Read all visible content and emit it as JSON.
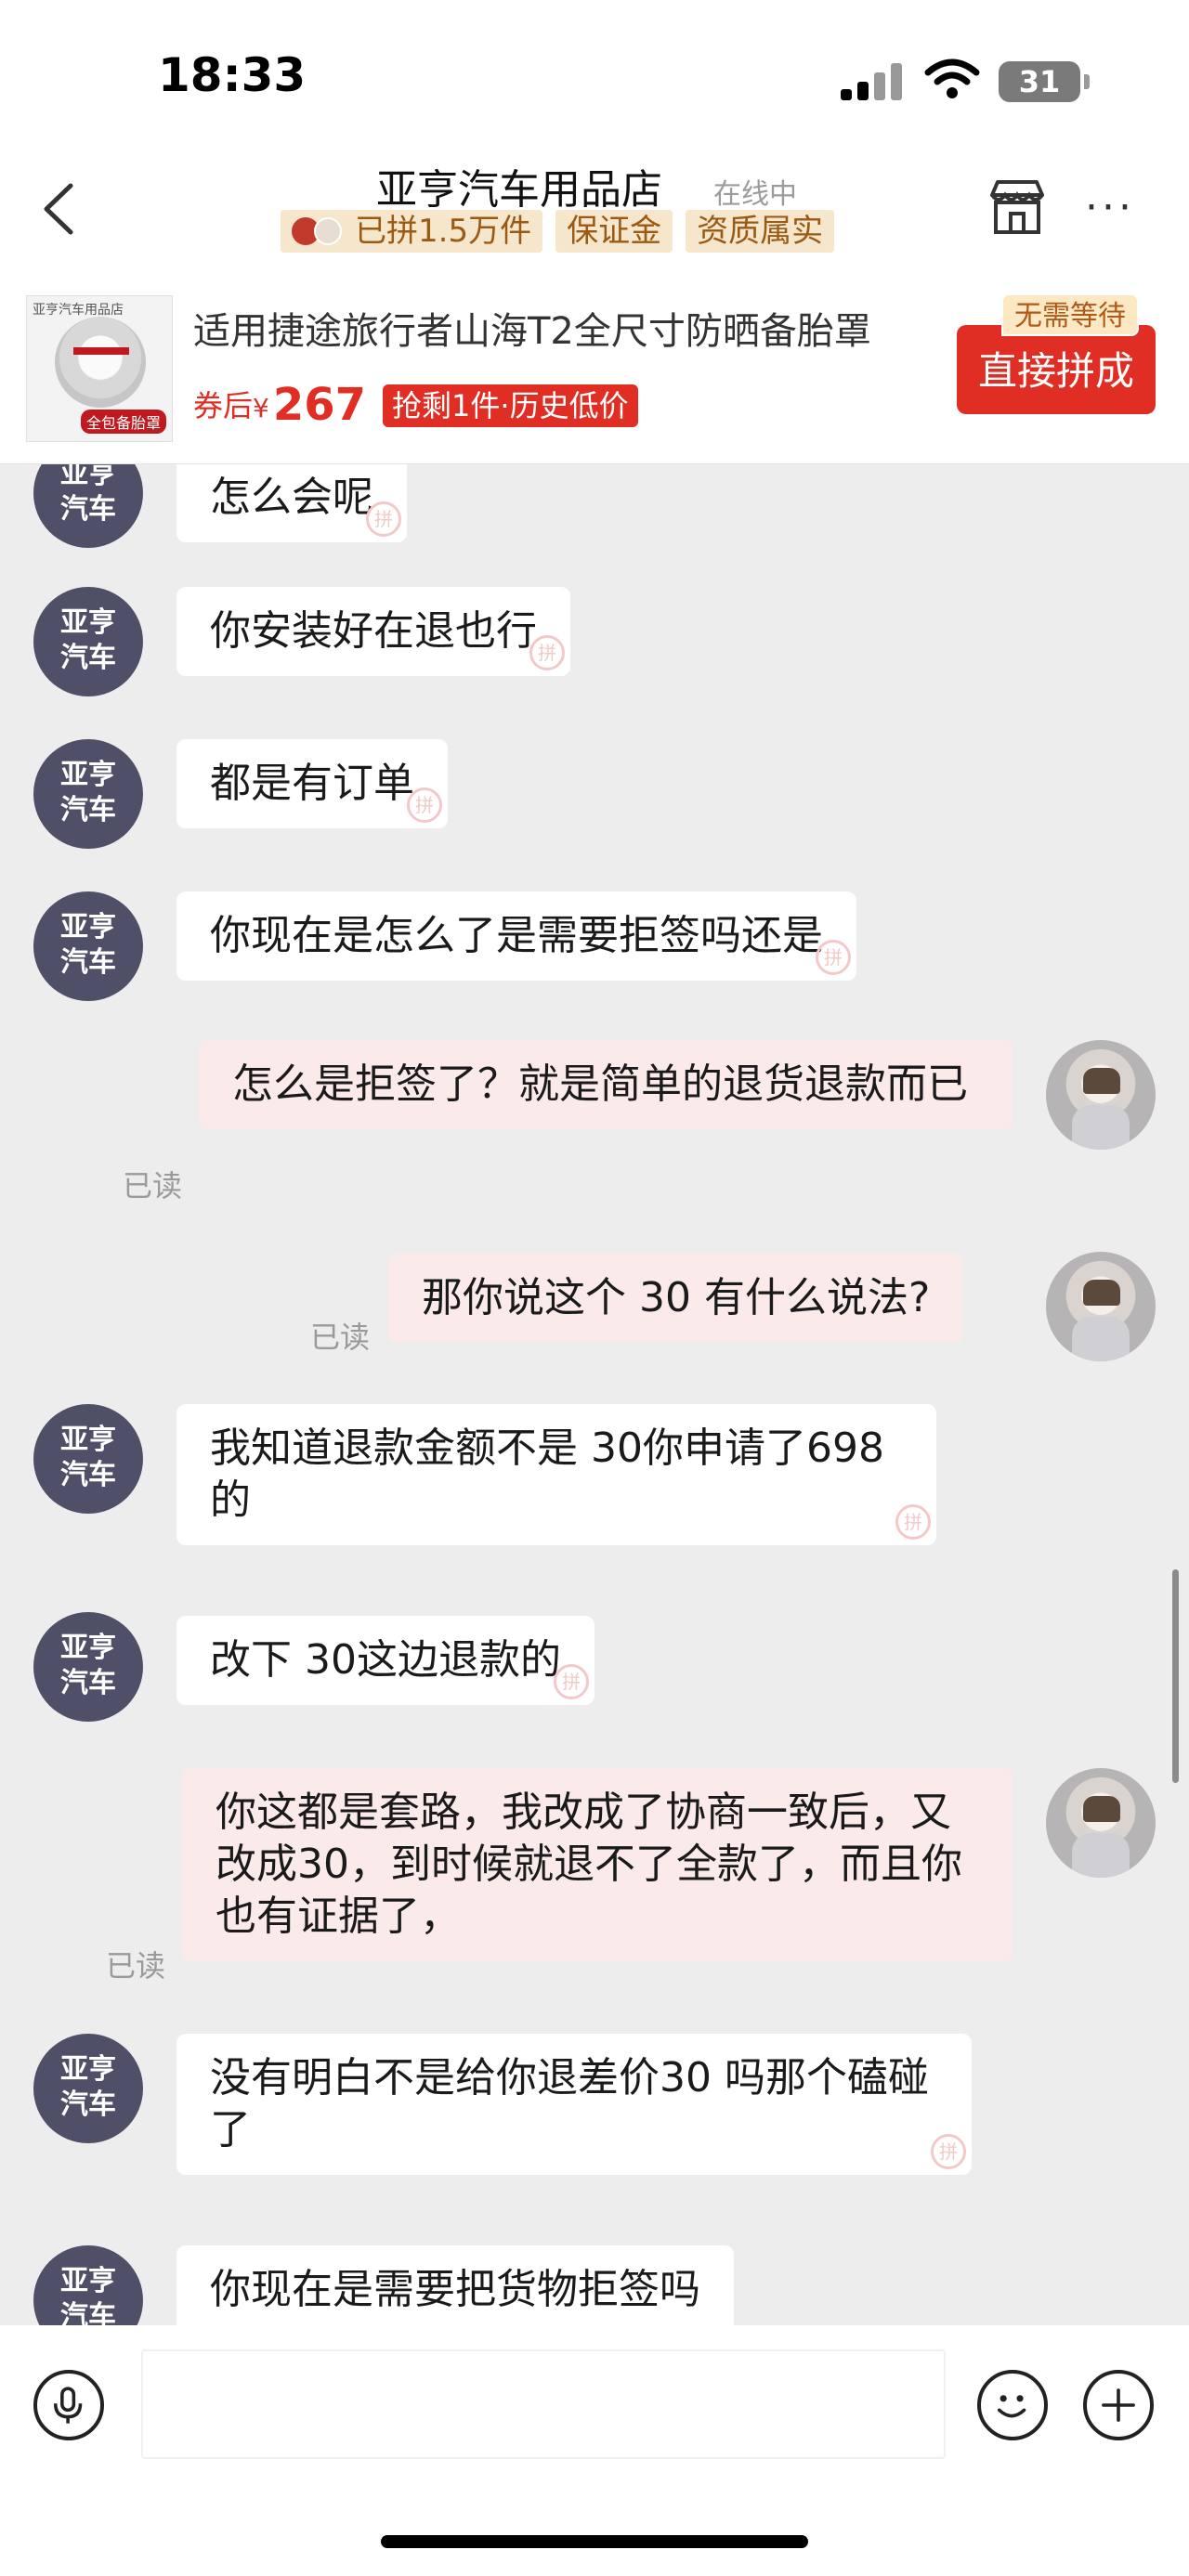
{
  "status_bar": {
    "time": "18:33",
    "battery": "31"
  },
  "header": {
    "title": "亚亨汽车用品店",
    "online_status": "在线中",
    "badges": [
      "已拼1.5万件",
      "保证金",
      "资质属实"
    ]
  },
  "product": {
    "image_shop_label": "亚亨汽车用品店",
    "image_tag": "全包备胎罩",
    "name": "适用捷途旅行者山海T2全尺寸防晒备胎罩",
    "price_prefix": "券后",
    "price_currency": "¥",
    "price": "267",
    "promo": "抢剩1件·历史低价",
    "buy_label": "直接拼成",
    "no_wait_label": "无需等待"
  },
  "shop_avatar_text": "亚亨\n汽车",
  "messages": [
    {
      "side": "in",
      "text": "怎么会呢"
    },
    {
      "side": "in",
      "text": "你安装好在退也行"
    },
    {
      "side": "in",
      "text": "都是有订单"
    },
    {
      "side": "in",
      "text": "你现在是怎么了是需要拒签吗还是"
    },
    {
      "side": "out",
      "text": "怎么是拒签了？就是简单的退货退款而已",
      "read": "已读"
    },
    {
      "side": "out",
      "text": "那你说这个 30 有什么说法?",
      "read": "已读"
    },
    {
      "side": "in",
      "text": "我知道退款金额不是 30你申请了698的"
    },
    {
      "side": "in",
      "text": "改下 30这边退款的"
    },
    {
      "side": "out",
      "text": "你这都是套路，我改成了协商一致后，又改成30，到时候就退不了全款了，而且你也有证据了，",
      "read": "已读"
    },
    {
      "side": "in",
      "text": "没有明白不是给你退差价30 吗那个磕碰了"
    },
    {
      "side": "in",
      "text": "你现在是需要把货物拒签吗"
    }
  ],
  "colors": {
    "accent_red": "#e02e24",
    "badge_bg": "#f6e6cc",
    "outgoing_bubble": "#fbeaea",
    "shop_avatar": "#4f5068",
    "chat_bg": "#ededed"
  },
  "icons": [
    "back-arrow-icon",
    "store-icon",
    "more-icon",
    "mic-icon",
    "emoji-icon",
    "plus-icon",
    "wifi-icon",
    "signal-icon"
  ]
}
